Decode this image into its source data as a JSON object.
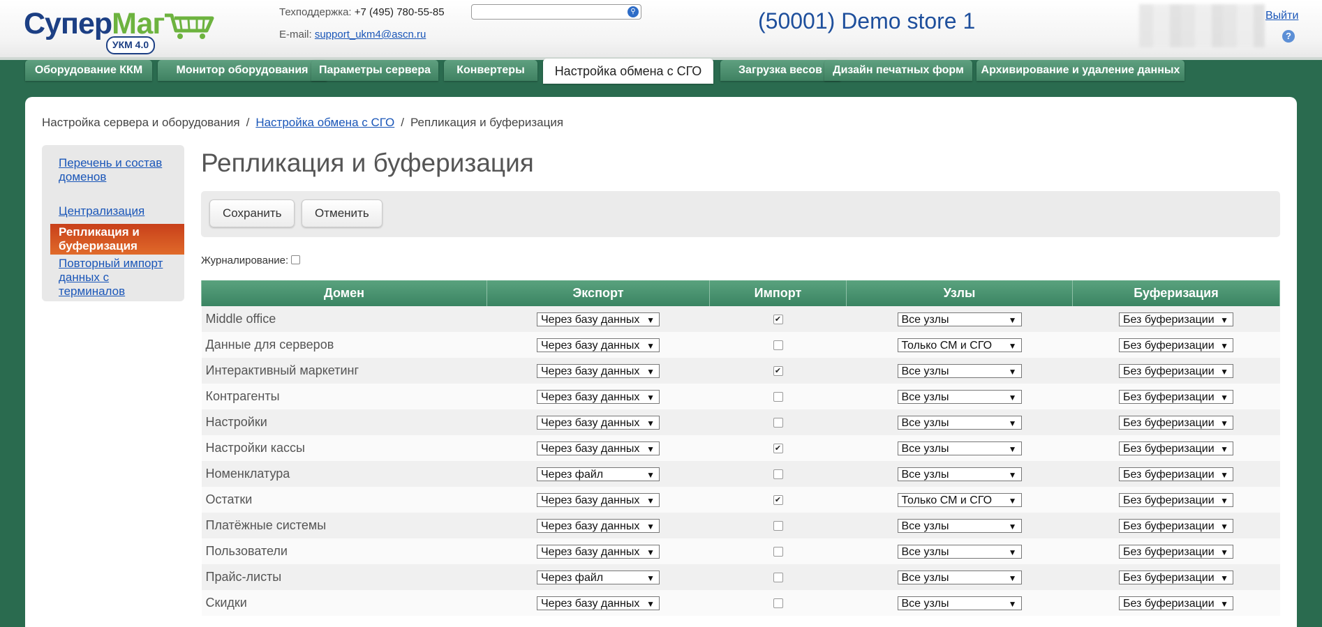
{
  "header": {
    "logo_part1": "Супер",
    "logo_part2": "Маг",
    "logo_badge": "УКМ 4.0",
    "support_label": "Техподдержка:",
    "support_phone": "+7 (495) 780-55-85",
    "email_label": "E-mail:",
    "email_value": "support_ukm4@ascn.ru",
    "search_placeholder": "",
    "store": "(50001) Demo store 1",
    "logout": "Выйти",
    "help": "?"
  },
  "tabs": [
    {
      "label": "Оборудование ККМ"
    },
    {
      "label": "Монитор оборудования"
    },
    {
      "label": "Параметры сервера"
    },
    {
      "label": "Конвертеры"
    },
    {
      "label": "Настройка обмена с СГО"
    },
    {
      "label": "Загрузка весов"
    },
    {
      "label": "Дизайн печатных форм"
    },
    {
      "label": "Архивирование и удаление данных"
    }
  ],
  "breadcrumb": {
    "root": "Настройка сервера и оборудования",
    "sep": "/",
    "parent": "Настройка обмена с СГО",
    "current": "Репликация и буферизация"
  },
  "sidebar": {
    "items": [
      {
        "label": "Перечень и состав доменов"
      },
      {
        "label": "Централизация"
      },
      {
        "label": "Репликация и буферизация"
      },
      {
        "label": "Повторный импорт данных с терминалов"
      }
    ]
  },
  "page": {
    "title": "Репликация и буферизация",
    "save": "Сохранить",
    "cancel": "Отменить",
    "logging_label": "Журналирование:"
  },
  "table": {
    "headers": [
      "Домен",
      "Экспорт",
      "Импорт",
      "Узлы",
      "Буферизация"
    ],
    "rows": [
      {
        "domain": "Middle office",
        "export": "Через базу данных",
        "import": true,
        "nodes": "Все узлы",
        "buffer": "Без буферизации"
      },
      {
        "domain": "Данные для серверов",
        "export": "Через базу данных",
        "import": false,
        "nodes": "Только СМ и СГО",
        "buffer": "Без буферизации"
      },
      {
        "domain": "Интерактивный маркетинг",
        "export": "Через базу данных",
        "import": true,
        "nodes": "Все узлы",
        "buffer": "Без буферизации"
      },
      {
        "domain": "Контрагенты",
        "export": "Через базу данных",
        "import": false,
        "nodes": "Все узлы",
        "buffer": "Без буферизации"
      },
      {
        "domain": "Настройки",
        "export": "Через базу данных",
        "import": false,
        "nodes": "Все узлы",
        "buffer": "Без буферизации"
      },
      {
        "domain": "Настройки кассы",
        "export": "Через базу данных",
        "import": true,
        "nodes": "Все узлы",
        "buffer": "Без буферизации"
      },
      {
        "domain": "Номенклатура",
        "export": "Через файл",
        "import": false,
        "nodes": "Все узлы",
        "buffer": "Без буферизации"
      },
      {
        "domain": "Остатки",
        "export": "Через базу данных",
        "import": true,
        "nodes": "Только СМ и СГО",
        "buffer": "Без буферизации"
      },
      {
        "domain": "Платёжные системы",
        "export": "Через базу данных",
        "import": false,
        "nodes": "Все узлы",
        "buffer": "Без буферизации"
      },
      {
        "domain": "Пользователи",
        "export": "Через базу данных",
        "import": false,
        "nodes": "Все узлы",
        "buffer": "Без буферизации"
      },
      {
        "domain": "Прайс-листы",
        "export": "Через файл",
        "import": false,
        "nodes": "Все узлы",
        "buffer": "Без буферизации"
      },
      {
        "domain": "Скидки",
        "export": "Через базу данных",
        "import": false,
        "nodes": "Все узлы",
        "buffer": "Без буферизации"
      }
    ]
  },
  "icons": {
    "dropdown": "▼",
    "check": "✔",
    "search": "search-icon",
    "cart": "cart-icon"
  },
  "colors": {
    "brand_blue": "#1c3f84",
    "brand_green": "#6db33f",
    "tab_green": "#3f8262",
    "active_nav": "#d4501f",
    "link": "#1a56b8"
  }
}
